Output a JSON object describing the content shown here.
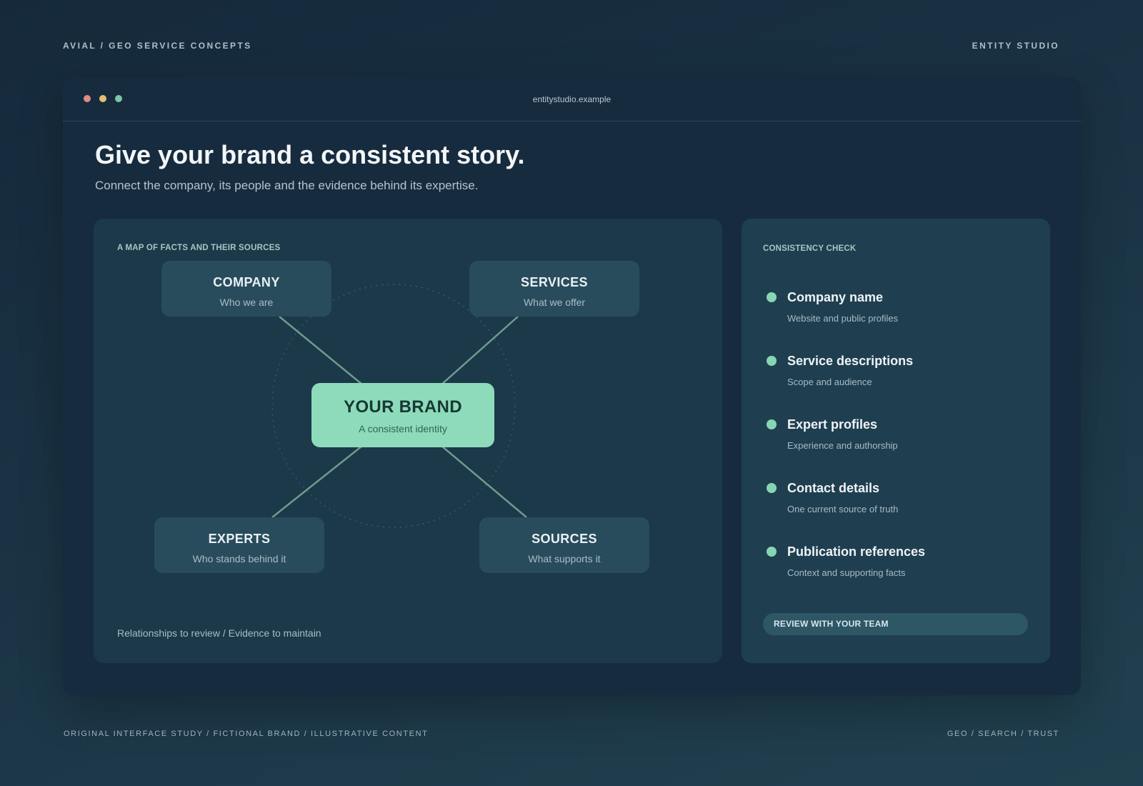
{
  "page": {
    "top_left": "AVIAL / GEO SERVICE CONCEPTS",
    "top_right": "ENTITY STUDIO",
    "bottom_left": "ORIGINAL INTERFACE STUDY / FICTIONAL BRAND / ILLUSTRATIVE CONTENT",
    "bottom_right": "GEO / SEARCH / TRUST"
  },
  "window": {
    "url": "entitystudio.example",
    "headline": "Give your brand a consistent story.",
    "subhead": "Connect the company, its people and the evidence behind its expertise."
  },
  "map": {
    "label": "A MAP OF FACTS AND THEIR SOURCES",
    "center": {
      "title": "YOUR BRAND",
      "subtitle": "A consistent identity"
    },
    "nodes": [
      {
        "title": "COMPANY",
        "subtitle": "Who we are"
      },
      {
        "title": "SERVICES",
        "subtitle": "What we offer"
      },
      {
        "title": "EXPERTS",
        "subtitle": "Who stands behind it"
      },
      {
        "title": "SOURCES",
        "subtitle": "What supports it"
      }
    ],
    "footer": "Relationships to review / Evidence to maintain"
  },
  "check": {
    "label": "CONSISTENCY CHECK",
    "items": [
      {
        "title": "Company name",
        "subtitle": "Website and public profiles"
      },
      {
        "title": "Service descriptions",
        "subtitle": "Scope and audience"
      },
      {
        "title": "Expert profiles",
        "subtitle": "Experience and authorship"
      },
      {
        "title": "Contact details",
        "subtitle": "One current source of truth"
      },
      {
        "title": "Publication references",
        "subtitle": "Context and supporting facts"
      }
    ],
    "button": "REVIEW WITH YOUR TEAM"
  },
  "colors": {
    "accent": "#8ddbbb",
    "panel": "#1b3949",
    "window": "#172b3f"
  }
}
